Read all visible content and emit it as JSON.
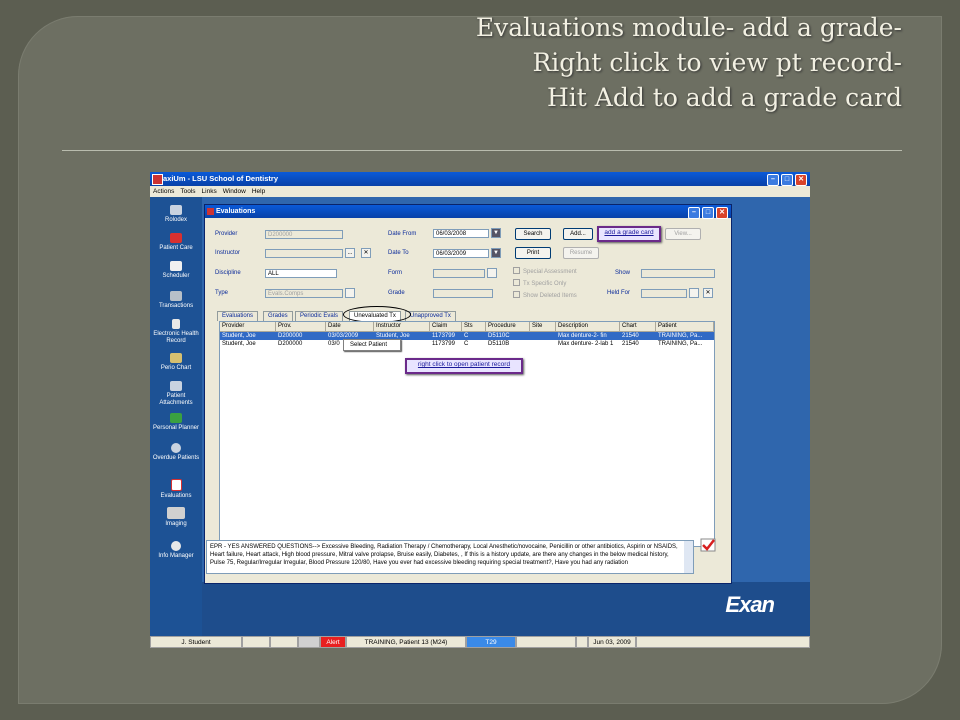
{
  "slide": {
    "title_line1": "Evaluations module- add a grade-",
    "title_line2": "Right click to view pt record-",
    "title_line3": "Hit Add to add a grade card"
  },
  "app": {
    "window_title": "axiUm - LSU School of Dentistry",
    "menu": [
      "Actions",
      "Tools",
      "Links",
      "Window",
      "Help"
    ],
    "brand": "Exan"
  },
  "sidebar": {
    "items": [
      {
        "label": "Rolodex",
        "icon": "rolodex-icon"
      },
      {
        "label": "Patient Care",
        "icon": "patient-care-icon"
      },
      {
        "label": "Scheduler",
        "icon": "scheduler-icon"
      },
      {
        "label": "Transactions",
        "icon": "calculator-icon"
      },
      {
        "label": "Electronic Health Record",
        "icon": "ehr-icon"
      },
      {
        "label": "Perio Chart",
        "icon": "perio-chart-icon"
      },
      {
        "label": "Patient Attachments",
        "icon": "attachments-icon"
      },
      {
        "label": "Personal Planner",
        "icon": "planner-icon"
      },
      {
        "label": "Overdue Patients",
        "icon": "overdue-icon"
      },
      {
        "label": "Evaluations",
        "icon": "evaluations-icon"
      },
      {
        "label": "Imaging",
        "icon": "camera-icon"
      },
      {
        "label": "Info Manager",
        "icon": "info-icon"
      }
    ]
  },
  "evaluations": {
    "title": "Evaluations",
    "provider_label": "Provider",
    "provider_value": "D200000",
    "instructor_label": "Instructor",
    "discipline_label": "Discipline",
    "discipline_value": "ALL",
    "type_label": "Type",
    "type_value": "Evals.Comps",
    "date_from_label": "Date From",
    "date_from_value": "06/03/2008",
    "date_to_label": "Date To",
    "date_to_value": "06/03/2009",
    "form_label": "Form",
    "grade_label": "Grade",
    "search_button": "Search",
    "print_button": "Print",
    "add_button": "Add...",
    "view_button": "View...",
    "resume_button": "Resume",
    "special_assessment": "Special Assessment",
    "tx_specific_only": "Tx Specific Only",
    "show_deleted_items": "Show Deleted Items",
    "show_label": "Show",
    "held_for_label": "Held For",
    "tabs": [
      "Evaluations",
      "Grades",
      "Periodic Evals",
      "Unevaluated Tx",
      "Unapproved Tx"
    ],
    "active_tab": "Unevaluated Tx",
    "columns": [
      "Provider",
      "Prov.",
      "Date",
      "Instructor",
      "Claim",
      "Sts",
      "Procedure",
      "Site",
      "Description",
      "Chart",
      "Patient"
    ],
    "rows": [
      [
        "Student, Joe",
        "D200000",
        "03/03/2009",
        "Student, Joe",
        "1173799",
        "C",
        "D5110C",
        "",
        "Max denture-2- fin",
        "21540",
        "TRAINING, Pa..."
      ],
      [
        "Student, Joe",
        "D200000",
        "03/0",
        "n",
        "1173799",
        "C",
        "D5110B",
        "",
        "Max denture- 2-lab 1",
        "21540",
        "TRAINING, Pa..."
      ]
    ],
    "context_menu_item": "Select Patient",
    "callout_add": "add a grade card",
    "callout_right_click": "right click to open patient record",
    "epr_text": "EPR - YES ANSWERED QUESTIONS--> Excessive Bleeding, Radiation Therapy / Chemotherapy, Local Anesthetic/novocaine, Penicillin or other antibiotics, Aspirin or NSAIDS, Heart failure, Heart attack, High blood pressure, Mitral valve prolapse, Bruise easily, Diabetes, , If this is a history update, are there any changes in the below medical history, Pulse 75,      Regular/Irregular Irregular, Blood Pressure 120/80, Have you ever had excessive bleeding requiring special treatment?, Have you had any radiation"
  },
  "status_bar": {
    "user": "J. Student",
    "alert": "Alert",
    "patient": "TRAINING, Patient 13 (M24)",
    "code": "T29",
    "date": "Jun 03, 2009"
  },
  "colors": {
    "alert": "#e82020",
    "selection": "#316ac5",
    "callout_border": "#6b2a8a"
  }
}
